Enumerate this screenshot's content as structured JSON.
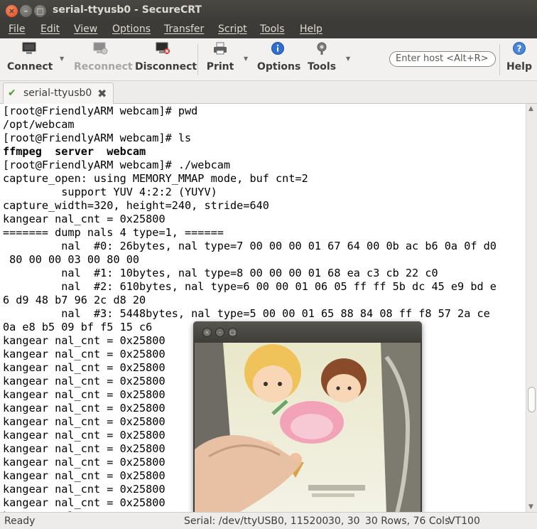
{
  "window": {
    "title": "serial-ttyusb0 - SecureCRT",
    "close_glyph": "×",
    "min_glyph": "–",
    "max_glyph": "□"
  },
  "menu": [
    "File",
    "Edit",
    "View",
    "Options",
    "Transfer",
    "Script",
    "Tools",
    "Help"
  ],
  "toolbar": {
    "connect": "Connect",
    "reconnect": "Reconnect",
    "disconnect": "Disconnect",
    "print": "Print",
    "options": "Options",
    "tools": "Tools",
    "help": "Help",
    "host_placeholder": "Enter host <Alt+R>"
  },
  "tab": {
    "label": "serial-ttyusb0",
    "check_glyph": "✔",
    "close_glyph": "✖"
  },
  "terminal": {
    "lines": [
      "[root@FriendlyARM webcam]# pwd",
      "/opt/webcam",
      "[root@FriendlyARM webcam]# ls",
      "ffmpeg  server  webcam",
      "[root@FriendlyARM webcam]# ./webcam",
      "capture_open: using MEMORY_MMAP mode, buf cnt=2",
      "         support YUV 4:2:2 (YUYV)",
      "capture_width=320, height=240, stride=640",
      "kangear nal_cnt = 0x25800",
      "======= dump nals 4 type=1, ======",
      "         nal  #0: 26bytes, nal type=7 00 00 00 01 67 64 00 0b ac b6 0a 0f d0",
      " 80 00 00 03 00 80 00",
      "         nal  #1: 10bytes, nal type=8 00 00 00 01 68 ea c3 cb 22 c0",
      "         nal  #2: 610bytes, nal type=6 00 00 01 06 05 ff ff 5b dc 45 e9 bd e",
      "6 d9 48 b7 96 2c d8 20",
      "         nal  #3: 5448bytes, nal type=5 00 00 01 65 88 84 08 ff f8 57 2a ce",
      "0a e8 b5 09 bf f5 15 c6",
      "kangear nal_cnt = 0x25800",
      "kangear nal_cnt = 0x25800",
      "kangear nal_cnt = 0x25800",
      "kangear nal_cnt = 0x25800",
      "kangear nal_cnt = 0x25800",
      "kangear nal_cnt = 0x25800",
      "kangear nal_cnt = 0x25800",
      "kangear nal_cnt = 0x25800",
      "kangear nal_cnt = 0x25800",
      "kangear nal_cnt = 0x25800",
      "kangear nal_cnt = 0x25800",
      "kangear nal_cnt = 0x25800",
      "kangear nal_cnt = 0x25800",
      "kangear nal_cnt = 0x25800"
    ],
    "bold_line_index": 3
  },
  "webcam_window": {
    "close_glyph": "×",
    "min_glyph": "–",
    "max_glyph": "□"
  },
  "status": {
    "ready": "Ready",
    "connection": "Serial: /dev/ttyUSB0, 115200",
    "cursor": "30, 30",
    "size": "30 Rows, 76 Cols",
    "emulation": "VT100"
  }
}
